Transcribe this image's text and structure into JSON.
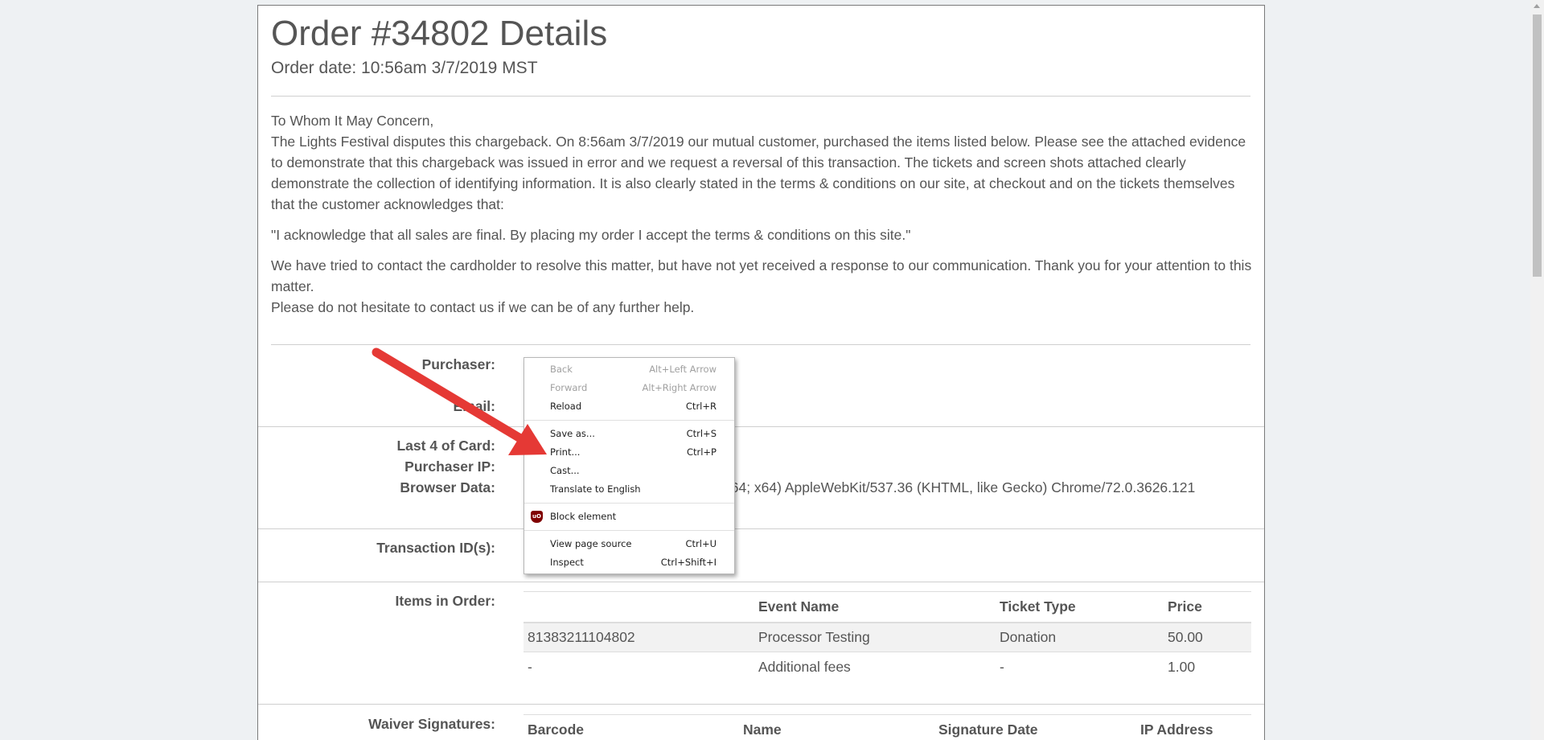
{
  "order": {
    "title": "Order #34802 Details",
    "date": "Order date: 10:56am 3/7/2019 MST"
  },
  "letter": {
    "greeting": "To Whom It May Concern,",
    "paragraph1": "The Lights Festival disputes this chargeback. On 8:56am 3/7/2019 our mutual customer, purchased the items listed below. Please see the attached evidence to demonstrate that this chargeback was issued in error and we request a reversal of this transaction. The tickets and screen shots attached clearly demonstrate the collection of identifying information. It is also clearly stated in the terms & conditions on our site, at checkout and on the tickets themselves that the customer acknowledges that:",
    "quote": "\"I acknowledge that all sales are final. By placing my order I accept the terms & conditions on this site.\"",
    "paragraph2": "We have tried to contact the cardholder to resolve this matter, but have not yet received a response to our communication. Thank you for your attention to this matter.",
    "closing": "Please do not hesitate to contact us if we can be of any further help."
  },
  "details": {
    "purchaser_label": "Purchaser:",
    "email_label": "Email:",
    "last4_label": "Last 4 of Card:",
    "ip_label": "Purchaser IP:",
    "browser_label": "Browser Data:",
    "browser_value": "n64; x64) AppleWebKit/537.36 (KHTML, like Gecko) Chrome/72.0.3626.121",
    "transaction_label": "Transaction ID(s):",
    "items_label": "Items in Order:",
    "waiver_label": "Waiver Signatures:"
  },
  "items_table": {
    "headers": [
      "",
      "Event Name",
      "Ticket Type",
      "Price"
    ],
    "rows": [
      [
        "81383211104802",
        "Processor Testing",
        "Donation",
        "50.00"
      ],
      [
        "-",
        "Additional fees",
        "-",
        "1.00"
      ]
    ]
  },
  "waiver_table": {
    "headers": [
      "Barcode",
      "Name",
      "Signature Date",
      "IP Address"
    ]
  },
  "context_menu": {
    "items": [
      {
        "label": "Back",
        "shortcut": "Alt+Left Arrow"
      },
      {
        "label": "Forward",
        "shortcut": "Alt+Right Arrow"
      },
      {
        "label": "Reload",
        "shortcut": "Ctrl+R"
      },
      {
        "label": "Save as...",
        "shortcut": "Ctrl+S"
      },
      {
        "label": "Print...",
        "shortcut": "Ctrl+P"
      },
      {
        "label": "Cast...",
        "shortcut": ""
      },
      {
        "label": "Translate to English",
        "shortcut": ""
      },
      {
        "label": "Block element",
        "shortcut": ""
      },
      {
        "label": "View page source",
        "shortcut": "Ctrl+U"
      },
      {
        "label": "Inspect",
        "shortcut": "Ctrl+Shift+I"
      }
    ]
  },
  "colors": {
    "arrow": "#e53935",
    "ublock": "#800000"
  },
  "icons": {
    "ublock": "ublock-origin-icon",
    "arrow": "annotation-arrow-icon"
  }
}
